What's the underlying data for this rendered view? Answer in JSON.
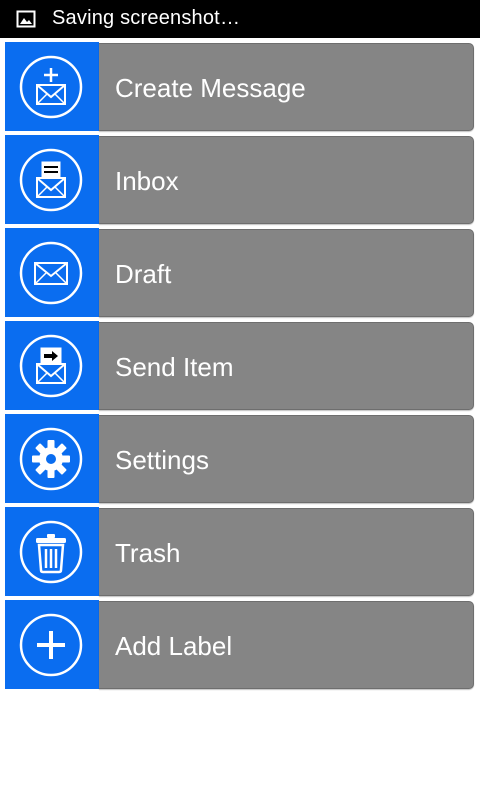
{
  "status_bar": {
    "icon": "image-icon",
    "text": "Saving screenshot…"
  },
  "colors": {
    "accent": "#0a6df0",
    "panel": "#858585",
    "status_bar": "#000000"
  },
  "menu": {
    "items": [
      {
        "label": "Create Message",
        "icon": "compose-mail-icon"
      },
      {
        "label": "Inbox",
        "icon": "inbox-icon"
      },
      {
        "label": "Draft",
        "icon": "envelope-icon"
      },
      {
        "label": "Send Item",
        "icon": "sent-mail-icon"
      },
      {
        "label": "Settings",
        "icon": "gear-icon"
      },
      {
        "label": "Trash",
        "icon": "trash-icon"
      },
      {
        "label": "Add Label",
        "icon": "plus-icon"
      }
    ]
  }
}
